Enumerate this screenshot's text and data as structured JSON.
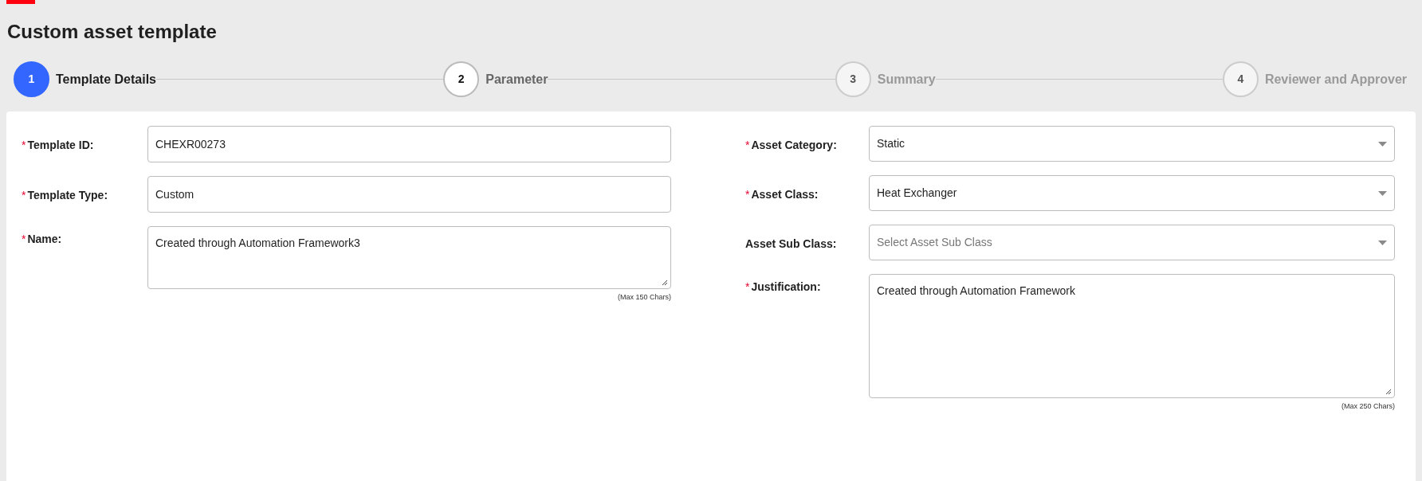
{
  "page": {
    "title": "Custom asset template"
  },
  "steps": [
    {
      "number": "1",
      "label": "Template Details",
      "selected": true,
      "disabled": false
    },
    {
      "number": "2",
      "label": "Parameter",
      "selected": false,
      "disabled": false
    },
    {
      "number": "3",
      "label": "Summary",
      "selected": false,
      "disabled": true
    },
    {
      "number": "4",
      "label": "Reviewer and Approver",
      "selected": false,
      "disabled": true
    }
  ],
  "form": {
    "left_fields": [
      {
        "kind": "text",
        "required_mark": "*",
        "label": "Template ID:",
        "value": "CHEXR00273"
      },
      {
        "kind": "text",
        "required_mark": "*",
        "label": "Template Type:",
        "value": "Custom"
      },
      {
        "kind": "textarea",
        "required_mark": "*",
        "label": "Name:",
        "value": "Created through Automation Framework3",
        "hint": "(Max 150 Chars)"
      }
    ],
    "right_fields": [
      {
        "kind": "select",
        "required_mark": "*",
        "label": "Asset Category:",
        "value": "Static"
      },
      {
        "kind": "select",
        "required_mark": "*",
        "label": "Asset Class:",
        "value": "Heat Exchanger"
      },
      {
        "kind": "select",
        "label": "Asset Sub Class:",
        "placeholder": "Select Asset Sub Class"
      },
      {
        "kind": "long_textarea",
        "required_mark": "*",
        "label": "Justification:",
        "value": "Created through Automation Framework",
        "hint": "(Max 250 Chars)"
      }
    ]
  }
}
